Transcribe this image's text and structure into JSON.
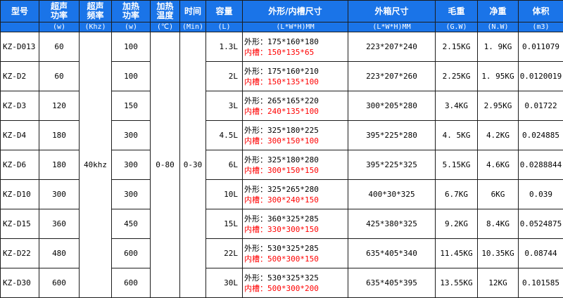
{
  "headers": {
    "model": "型号",
    "ultra_power": [
      "超声",
      "功率"
    ],
    "ultra_freq": [
      "超声",
      "频率"
    ],
    "heat_power": [
      "加热",
      "功率"
    ],
    "heat_temp": [
      "加热",
      "温度"
    ],
    "time": "时间",
    "volume": "容量",
    "dims": "外形/内槽尺寸",
    "box": "外箱尺寸",
    "gross": "毛重",
    "net": "净重",
    "size": "体积"
  },
  "units": {
    "model": "",
    "ultra_power": "(w)",
    "ultra_freq": "(Khz)",
    "heat_power": "(w)",
    "heat_temp": "(℃)",
    "time": "(Min)",
    "volume": "(L)",
    "dims": "(L*W*H)MM",
    "box": "(L*W*H)MM",
    "gross": "(G.W)",
    "net": "(N.W)",
    "size": "(m3)"
  },
  "shared": {
    "frequency": "40khz",
    "temperature": "0-80",
    "time": "0-30"
  },
  "rows": [
    {
      "model": "KZ-D013",
      "power": "60",
      "heat": "100",
      "volume": "1.3L",
      "outer": "外形：175*160*180",
      "inner": "内槽：150*135*65",
      "box": "223*207*240",
      "gross": "2.15KG",
      "net": "1. 9KG",
      "size": "0.011079"
    },
    {
      "model": "KZ-D2",
      "power": "60",
      "heat": "100",
      "volume": "2L",
      "outer": "外形：175*160*210",
      "inner": "内槽：150*135*100",
      "box": "223*207*260",
      "gross": "2.25KG",
      "net": "1. 95KG",
      "size": "0.0120019"
    },
    {
      "model": "KZ-D3",
      "power": "120",
      "heat": "150",
      "volume": "3L",
      "outer": "外形：265*165*220",
      "inner": "内槽：240*135*100",
      "box": "300*205*280",
      "gross": "3.4KG",
      "net": "2.95KG",
      "size": "0.01722"
    },
    {
      "model": "KZ-D4",
      "power": "180",
      "heat": "300",
      "volume": "4.5L",
      "outer": "外形：325*180*225",
      "inner": "内槽：300*150*100",
      "box": "395*225*280",
      "gross": "4. 5KG",
      "net": "4.2KG",
      "size": "0.024885"
    },
    {
      "model": "KZ-D6",
      "power": "180",
      "heat": "300",
      "volume": "6L",
      "outer": "外形：325*180*280",
      "inner": "内槽：300*150*150",
      "box": "395*225*325",
      "gross": "5.15KG",
      "net": "4.6KG",
      "size": "0.0288844"
    },
    {
      "model": "KZ-D10",
      "power": "300",
      "heat": "300",
      "volume": "10L",
      "outer": "外形：325*265*280",
      "inner": "内槽：300*240*150",
      "box": "400*30*325",
      "gross": "6.7KG",
      "net": "6KG",
      "size": "0.039"
    },
    {
      "model": "KZ-D15",
      "power": "360",
      "heat": "450",
      "volume": "15L",
      "outer": "外形：360*325*285",
      "inner": "内槽：330*300*150",
      "box": "425*380*325",
      "gross": "9.2KG",
      "net": "8.4KG",
      "size": "0.0524875"
    },
    {
      "model": "KZ-D22",
      "power": "480",
      "heat": "600",
      "volume": "22L",
      "outer": "外形：530*325*285",
      "inner": "内槽：500*300*150",
      "box": "635*405*340",
      "gross": "11.45KG",
      "net": "10.35KG",
      "size": "0.08744"
    },
    {
      "model": "KZ-D30",
      "power": "600",
      "heat": "600",
      "volume": "30L",
      "outer": "外形：530*325*325",
      "inner": "内槽：500*300*200",
      "box": "635*405*395",
      "gross": "13.55KG",
      "net": "12KG",
      "size": "0.101585"
    }
  ]
}
